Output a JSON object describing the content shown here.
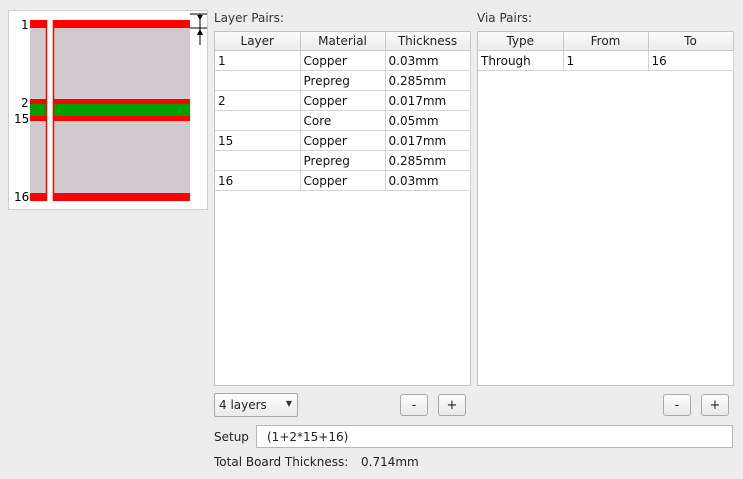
{
  "preview": {
    "layer_labels": [
      "1",
      "2",
      "15",
      "16"
    ],
    "colors": {
      "copper": "#ff0000",
      "dielectric": "#d0cacf",
      "core": "#00a000",
      "frame": "#ffffff"
    }
  },
  "layer_pairs": {
    "title": "Layer Pairs:",
    "columns": [
      "Layer",
      "Material",
      "Thickness"
    ],
    "rows": [
      {
        "layer": "1",
        "material": "Copper",
        "thickness": "0.03mm"
      },
      {
        "layer": "",
        "material": "Prepreg",
        "thickness": "0.285mm"
      },
      {
        "layer": "2",
        "material": "Copper",
        "thickness": "0.017mm"
      },
      {
        "layer": "",
        "material": "Core",
        "thickness": "0.05mm"
      },
      {
        "layer": "15",
        "material": "Copper",
        "thickness": "0.017mm"
      },
      {
        "layer": "",
        "material": "Prepreg",
        "thickness": "0.285mm"
      },
      {
        "layer": "16",
        "material": "Copper",
        "thickness": "0.03mm"
      }
    ],
    "layers_select": "4 layers",
    "minus_label": "-",
    "plus_label": "+"
  },
  "via_pairs": {
    "title": "Via Pairs:",
    "columns": [
      "Type",
      "From",
      "To"
    ],
    "rows": [
      {
        "type": "Through",
        "from": "1",
        "to": "16"
      }
    ],
    "minus_label": "-",
    "plus_label": "+"
  },
  "setup": {
    "label": "Setup",
    "value": "(1+2*15+16)"
  },
  "total": {
    "label": "Total Board Thickness:",
    "value": "0.714mm"
  }
}
